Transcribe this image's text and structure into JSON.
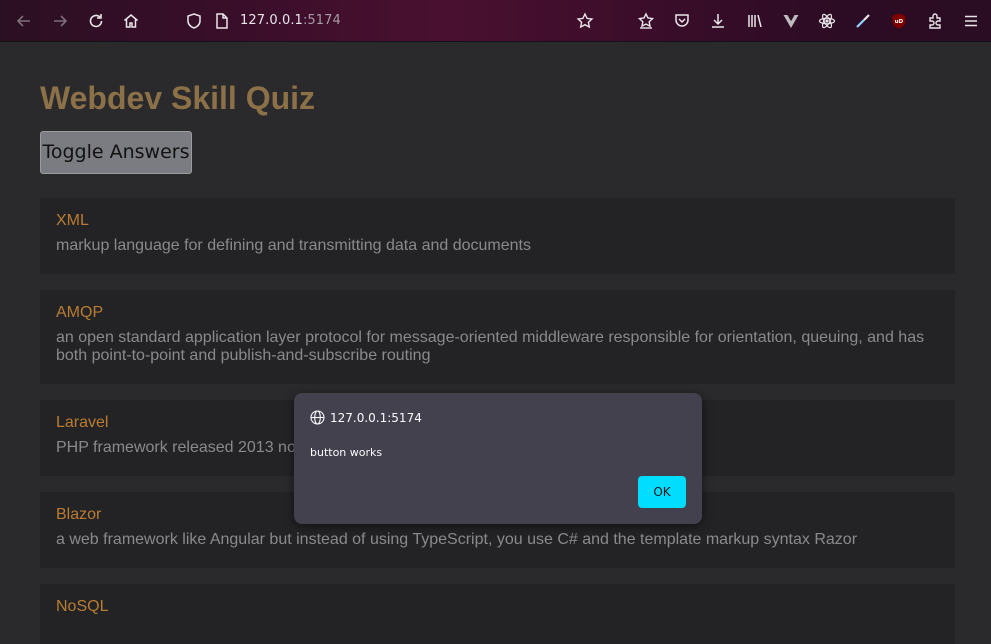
{
  "browser": {
    "url_host": "127.0.0.1",
    "url_port": ":5174",
    "icons": [
      "back-icon",
      "forward-icon",
      "reload-icon",
      "home-icon",
      "shield-icon",
      "page-icon",
      "bookmark-star-icon",
      "pocket-save-icon",
      "pocket-icon",
      "download-icon",
      "library-icon",
      "vue-devtools-icon",
      "react-devtools-icon",
      "eyedropper-icon",
      "ublock-icon",
      "extensions-icon",
      "menu-icon"
    ],
    "ublock_badge": "uD"
  },
  "page": {
    "title": "Webdev Skill Quiz",
    "toggle_label": "Toggle Answers",
    "cards": [
      {
        "term": "XML",
        "definition": "markup language for defining and transmitting data and documents"
      },
      {
        "term": "AMQP",
        "definition": "an open standard application layer protocol for message-oriented middleware responsible for orientation, queuing, and has both point-to-point and publish-and-subscribe routing"
      },
      {
        "term": "Laravel",
        "definition": "PHP framework released 2013 no"
      },
      {
        "term": "Blazor",
        "definition": "a web framework like Angular but instead of using TypeScript, you use C# and the template markup syntax Razor"
      },
      {
        "term": "NoSQL",
        "definition": ""
      }
    ]
  },
  "dialog": {
    "origin": "127.0.0.1:5174",
    "message": "button works",
    "ok_label": "OK"
  },
  "colors": {
    "title": "#8b7048",
    "term": "#b97c33",
    "definition": "#8a8a8d",
    "card_bg": "#232325",
    "ok_button": "#00ddff"
  }
}
